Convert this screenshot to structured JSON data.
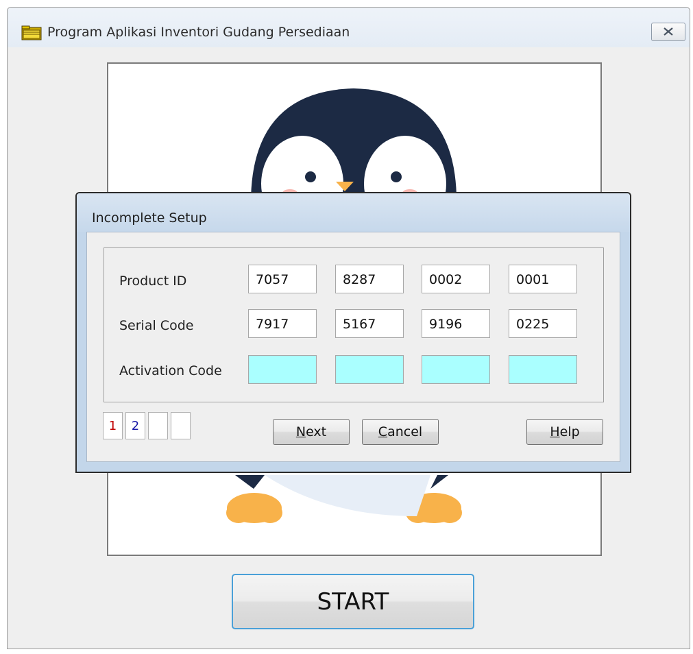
{
  "window": {
    "title": "Program Aplikasi Inventori Gudang Persediaan",
    "icon": "folder-icon",
    "close_icon": "close-icon"
  },
  "start_button": {
    "label": "START"
  },
  "dialog": {
    "title": "Incomplete Setup",
    "rows": [
      {
        "label": "Product ID",
        "values": [
          "7057",
          "8287",
          "0002",
          "0001"
        ]
      },
      {
        "label": "Serial Code",
        "values": [
          "7917",
          "5167",
          "9196",
          "0225"
        ]
      },
      {
        "label": "Activation Code",
        "values": [
          "",
          "",
          "",
          ""
        ]
      }
    ],
    "pages": [
      "1",
      "2",
      "",
      ""
    ],
    "page_colors": [
      "#c00000",
      "#1a1aa8"
    ],
    "buttons": {
      "next": {
        "mnemonic": "N",
        "rest": "ext"
      },
      "cancel": {
        "mnemonic": "C",
        "rest": "ancel"
      },
      "help": {
        "mnemonic": "H",
        "rest": "elp"
      }
    }
  },
  "colors": {
    "activation_field": "#aaffff",
    "start_border": "#4aa0d8",
    "penguin_dark": "#1c2a44",
    "penguin_feet": "#f8b24a"
  }
}
